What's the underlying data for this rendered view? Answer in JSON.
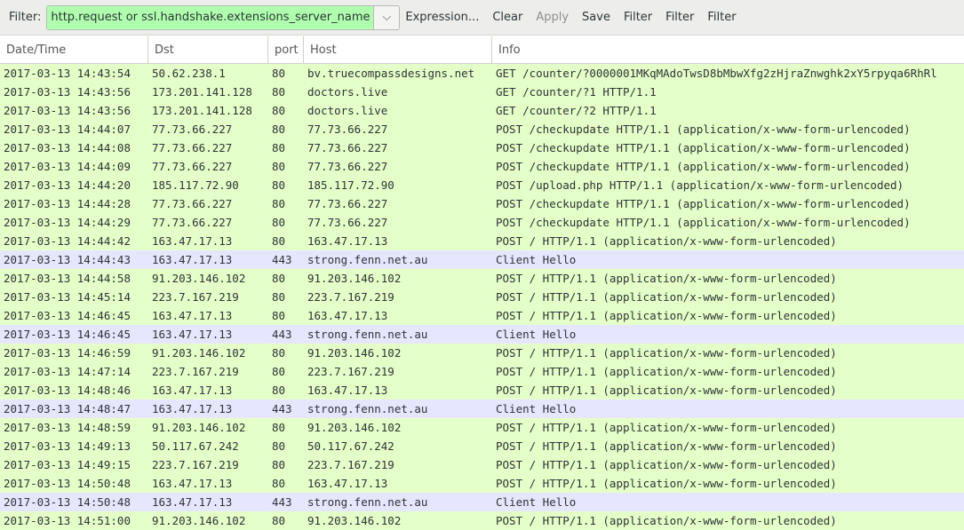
{
  "toolbar": {
    "filter_label": "Filter:",
    "filter_value": "http.request or ssl.handshake.extensions_server_name",
    "dropdown_glyph": "⌵",
    "expression_label": "Expression...",
    "clear_label": "Clear",
    "apply_label": "Apply",
    "save_label": "Save",
    "filter1_label": "Filter",
    "filter2_label": "Filter",
    "filter3_label": "Filter"
  },
  "columns": [
    "Date/Time",
    "Dst",
    "port",
    "Host",
    "Info"
  ],
  "colors": {
    "http_row": "#e4ffc7",
    "tls_row": "#e7e6ff",
    "filter_valid": "#afffaf"
  },
  "rows": [
    {
      "type": "http",
      "date": "2017-03-13 14:43:54",
      "dst": "50.62.238.1",
      "port": "80",
      "host": "bv.truecompassdesigns.net",
      "info": "GET /counter/?0000001MKqMAdoTwsD8bMbwXfg2zHjraZnwghk2xY5rpyqa6RhRl"
    },
    {
      "type": "http",
      "date": "2017-03-13 14:43:56",
      "dst": "173.201.141.128",
      "port": "80",
      "host": "doctors.live",
      "info": "GET /counter/?1 HTTP/1.1"
    },
    {
      "type": "http",
      "date": "2017-03-13 14:43:56",
      "dst": "173.201.141.128",
      "port": "80",
      "host": "doctors.live",
      "info": "GET /counter/?2 HTTP/1.1"
    },
    {
      "type": "http",
      "date": "2017-03-13 14:44:07",
      "dst": "77.73.66.227",
      "port": "80",
      "host": "77.73.66.227",
      "info": "POST /checkupdate HTTP/1.1  (application/x-www-form-urlencoded)"
    },
    {
      "type": "http",
      "date": "2017-03-13 14:44:08",
      "dst": "77.73.66.227",
      "port": "80",
      "host": "77.73.66.227",
      "info": "POST /checkupdate HTTP/1.1  (application/x-www-form-urlencoded)"
    },
    {
      "type": "http",
      "date": "2017-03-13 14:44:09",
      "dst": "77.73.66.227",
      "port": "80",
      "host": "77.73.66.227",
      "info": "POST /checkupdate HTTP/1.1  (application/x-www-form-urlencoded)"
    },
    {
      "type": "http",
      "date": "2017-03-13 14:44:20",
      "dst": "185.117.72.90",
      "port": "80",
      "host": "185.117.72.90",
      "info": "POST /upload.php HTTP/1.1  (application/x-www-form-urlencoded)"
    },
    {
      "type": "http",
      "date": "2017-03-13 14:44:28",
      "dst": "77.73.66.227",
      "port": "80",
      "host": "77.73.66.227",
      "info": "POST /checkupdate HTTP/1.1  (application/x-www-form-urlencoded)"
    },
    {
      "type": "http",
      "date": "2017-03-13 14:44:29",
      "dst": "77.73.66.227",
      "port": "80",
      "host": "77.73.66.227",
      "info": "POST /checkupdate HTTP/1.1  (application/x-www-form-urlencoded)"
    },
    {
      "type": "http",
      "date": "2017-03-13 14:44:42",
      "dst": "163.47.17.13",
      "port": "80",
      "host": "163.47.17.13",
      "info": "POST / HTTP/1.1  (application/x-www-form-urlencoded)"
    },
    {
      "type": "tls",
      "date": "2017-03-13 14:44:43",
      "dst": "163.47.17.13",
      "port": "443",
      "host": "strong.fenn.net.au",
      "info": "Client Hello"
    },
    {
      "type": "http",
      "date": "2017-03-13 14:44:58",
      "dst": "91.203.146.102",
      "port": "80",
      "host": "91.203.146.102",
      "info": "POST / HTTP/1.1  (application/x-www-form-urlencoded)"
    },
    {
      "type": "http",
      "date": "2017-03-13 14:45:14",
      "dst": "223.7.167.219",
      "port": "80",
      "host": "223.7.167.219",
      "info": "POST / HTTP/1.1  (application/x-www-form-urlencoded)"
    },
    {
      "type": "http",
      "date": "2017-03-13 14:46:45",
      "dst": "163.47.17.13",
      "port": "80",
      "host": "163.47.17.13",
      "info": "POST / HTTP/1.1  (application/x-www-form-urlencoded)"
    },
    {
      "type": "tls",
      "date": "2017-03-13 14:46:45",
      "dst": "163.47.17.13",
      "port": "443",
      "host": "strong.fenn.net.au",
      "info": "Client Hello"
    },
    {
      "type": "http",
      "date": "2017-03-13 14:46:59",
      "dst": "91.203.146.102",
      "port": "80",
      "host": "91.203.146.102",
      "info": "POST / HTTP/1.1  (application/x-www-form-urlencoded)"
    },
    {
      "type": "http",
      "date": "2017-03-13 14:47:14",
      "dst": "223.7.167.219",
      "port": "80",
      "host": "223.7.167.219",
      "info": "POST / HTTP/1.1  (application/x-www-form-urlencoded)"
    },
    {
      "type": "http",
      "date": "2017-03-13 14:48:46",
      "dst": "163.47.17.13",
      "port": "80",
      "host": "163.47.17.13",
      "info": "POST / HTTP/1.1  (application/x-www-form-urlencoded)"
    },
    {
      "type": "tls",
      "date": "2017-03-13 14:48:47",
      "dst": "163.47.17.13",
      "port": "443",
      "host": "strong.fenn.net.au",
      "info": "Client Hello"
    },
    {
      "type": "http",
      "date": "2017-03-13 14:48:59",
      "dst": "91.203.146.102",
      "port": "80",
      "host": "91.203.146.102",
      "info": "POST / HTTP/1.1  (application/x-www-form-urlencoded)"
    },
    {
      "type": "http",
      "date": "2017-03-13 14:49:13",
      "dst": "50.117.67.242",
      "port": "80",
      "host": "50.117.67.242",
      "info": "POST / HTTP/1.1  (application/x-www-form-urlencoded)"
    },
    {
      "type": "http",
      "date": "2017-03-13 14:49:15",
      "dst": "223.7.167.219",
      "port": "80",
      "host": "223.7.167.219",
      "info": "POST / HTTP/1.1  (application/x-www-form-urlencoded)"
    },
    {
      "type": "http",
      "date": "2017-03-13 14:50:48",
      "dst": "163.47.17.13",
      "port": "80",
      "host": "163.47.17.13",
      "info": "POST / HTTP/1.1  (application/x-www-form-urlencoded)"
    },
    {
      "type": "tls",
      "date": "2017-03-13 14:50:48",
      "dst": "163.47.17.13",
      "port": "443",
      "host": "strong.fenn.net.au",
      "info": "Client Hello"
    },
    {
      "type": "http",
      "date": "2017-03-13 14:51:00",
      "dst": "91.203.146.102",
      "port": "80",
      "host": "91.203.146.102",
      "info": "POST / HTTP/1.1  (application/x-www-form-urlencoded)"
    }
  ]
}
